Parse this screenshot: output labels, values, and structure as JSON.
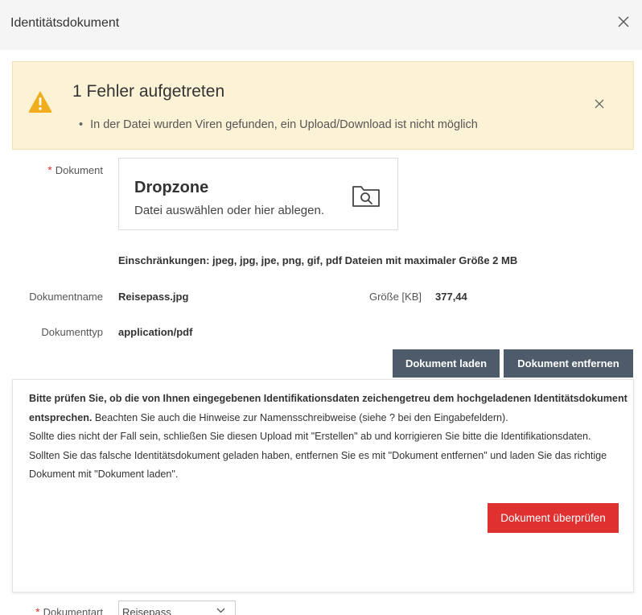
{
  "dialog": {
    "title": "Identitätsdokument"
  },
  "alert": {
    "title": "1 Fehler aufgetreten",
    "items": [
      "In der Datei wurden Viren gefunden, ein Upload/Download ist nicht möglich"
    ]
  },
  "form": {
    "required_mark": "*",
    "document_label": "Dokument",
    "dropzone_title": "Dropzone",
    "dropzone_subtitle": "Datei auswählen oder hier ablegen.",
    "restrictions": "Einschränkungen: jpeg, jpg, jpe, png, gif, pdf Dateien mit maximaler Größe 2 MB",
    "name_label": "Dokumentname",
    "name_value": "Reisepass.jpg",
    "size_label": "Größe [KB]",
    "size_value": "377,44",
    "type_label": "Dokumenttyp",
    "type_value": "application/pdf",
    "load_button": "Dokument laden",
    "remove_button": "Dokument entfernen",
    "doctype_label": "Dokumentart",
    "doctype_value": "Reisepass"
  },
  "notice": {
    "bold_part": "Bitte prüfen Sie, ob die von Ihnen eingegebenen Identifikationsdaten zeichengetreu dem hochgeladenen Identitätsdokument entsprechen.",
    "line1_rest": " Beachten Sie auch die Hinweise zur Namensschreibweise (siehe ? bei den Eingabefeldern).",
    "line2": "Sollte dies nicht der Fall sein, schließen Sie diesen Upload mit \"Erstellen\" ab und korrigieren Sie bitte die Identifikationsdaten.",
    "line3": "Sollten Sie das falsche Identitätsdokument geladen haben, entfernen Sie es mit \"Dokument entfernen\" und laden Sie das richtige Dokument mit \"Dokument laden\".",
    "check_button": "Dokument überprüfen"
  },
  "colors": {
    "alert_background": "#fcf3d7",
    "warning_icon": "#f0ad1e",
    "dark_button": "#4d5b6a",
    "danger_button": "#e03131",
    "required": "#e03131"
  }
}
